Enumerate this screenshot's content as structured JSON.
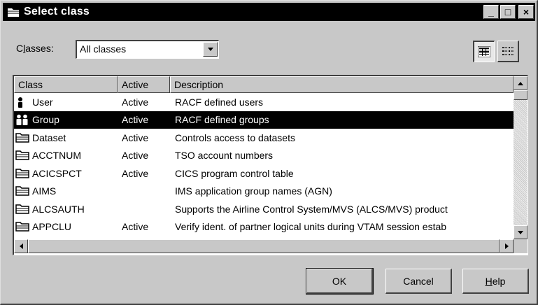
{
  "window": {
    "title": "Select class",
    "buttons": {
      "minimize": "_",
      "maximize": "□",
      "close": "×"
    }
  },
  "filter": {
    "label_accel": "l",
    "label_pre": "C",
    "label_post": "asses:",
    "selected": "All classes"
  },
  "list": {
    "columns": [
      "Class",
      "Active",
      "Description"
    ],
    "rows": [
      {
        "icon": "user-icon",
        "cls": "User",
        "active": "Active",
        "desc": "RACF defined users",
        "selected": false
      },
      {
        "icon": "group-icon",
        "cls": "Group",
        "active": "Active",
        "desc": "RACF defined groups",
        "selected": true
      },
      {
        "icon": "folder-icon",
        "cls": "Dataset",
        "active": "Active",
        "desc": "Controls access to datasets",
        "selected": false
      },
      {
        "icon": "folder-icon",
        "cls": "ACCTNUM",
        "active": "Active",
        "desc": "TSO account numbers",
        "selected": false
      },
      {
        "icon": "folder-icon",
        "cls": "ACICSPCT",
        "active": "Active",
        "desc": "CICS program control table",
        "selected": false
      },
      {
        "icon": "folder-icon",
        "cls": "AIMS",
        "active": "",
        "desc": "IMS application group names (AGN)",
        "selected": false
      },
      {
        "icon": "folder-icon",
        "cls": "ALCSAUTH",
        "active": "",
        "desc": "Supports the Airline Control System/MVS (ALCS/MVS) product",
        "selected": false
      },
      {
        "icon": "folder-icon",
        "cls": "APPCLU",
        "active": "Active",
        "desc": "Verify ident. of partner logical units during VTAM session estab",
        "selected": false
      }
    ]
  },
  "buttons": {
    "ok": "OK",
    "cancel": "Cancel",
    "help_accel": "H",
    "help_rest": "elp"
  },
  "colors": {
    "face": "#c8c8c8",
    "selection": "#000000",
    "titlebar": "#000000"
  }
}
